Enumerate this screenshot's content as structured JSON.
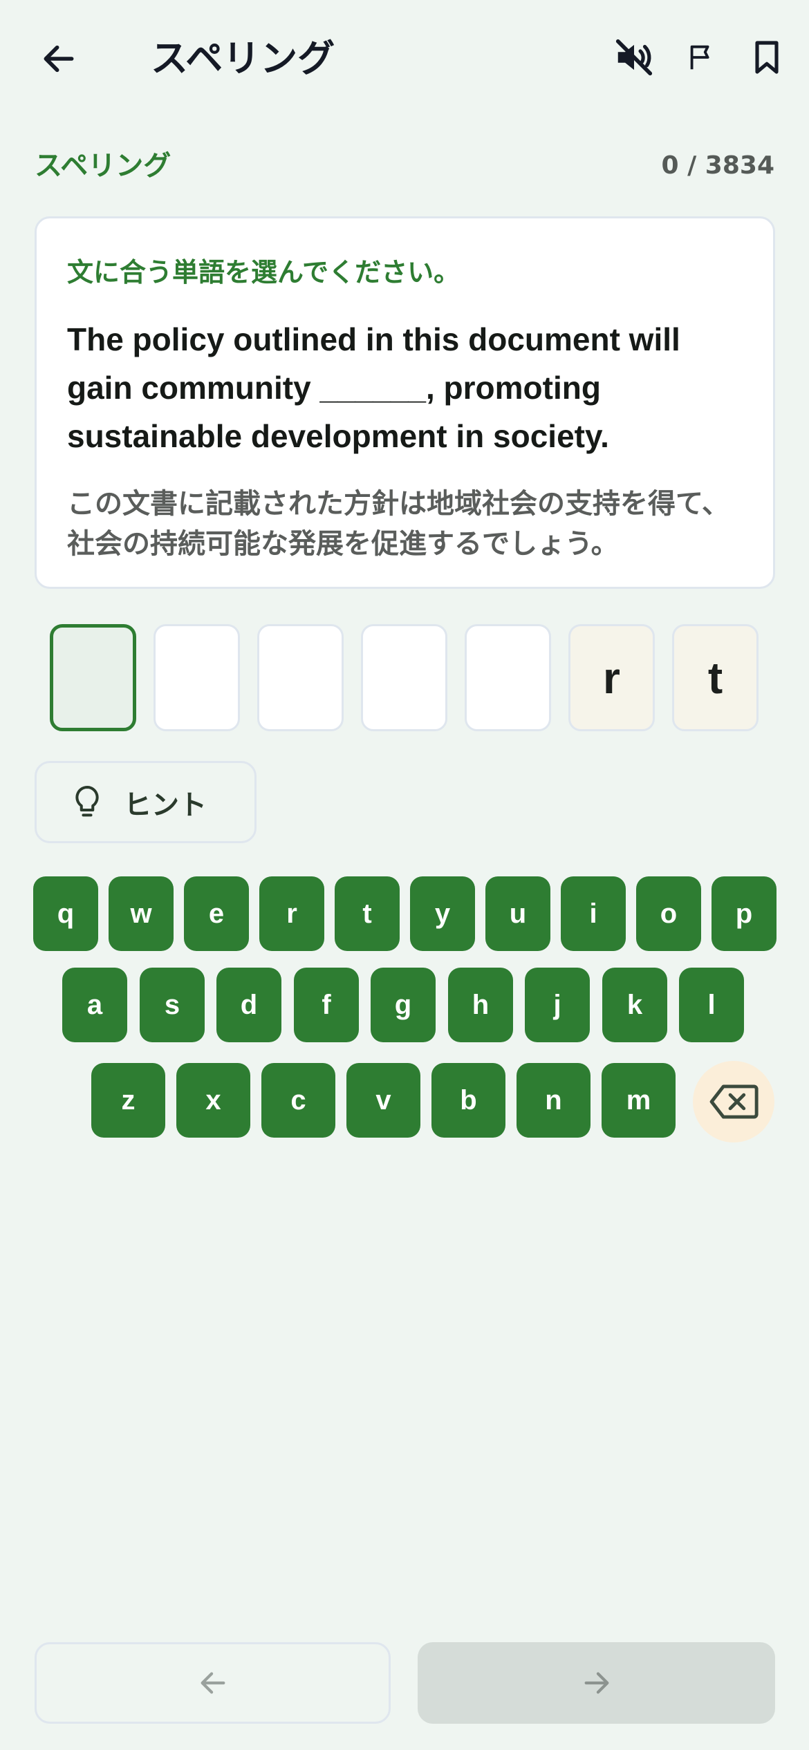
{
  "header": {
    "title": "スペリング",
    "back_icon": "arrow-left-icon",
    "mute_icon": "volume-off-icon",
    "flag_icon": "flag-icon",
    "bookmark_icon": "bookmark-icon"
  },
  "section": {
    "label": "スペリング",
    "progress": "0 / 3834"
  },
  "question": {
    "instruction": "文に合う単語を選んでください。",
    "sentence": "The policy outlined in this document will gain community ______, promoting sustainable development in society.",
    "translation": "この文書に記載された方針は地域社会の支持を得て、社会の持続可能な発展を促進するでしょう。"
  },
  "answer": {
    "letters": [
      "",
      "",
      "",
      "",
      "",
      "r",
      "t"
    ],
    "active_index": 0,
    "given_indices": [
      5,
      6
    ]
  },
  "hint": {
    "label": "ヒント",
    "icon": "lightbulb-icon"
  },
  "keyboard": {
    "row1": [
      "q",
      "w",
      "e",
      "r",
      "t",
      "y",
      "u",
      "i",
      "o",
      "p"
    ],
    "row2": [
      "a",
      "s",
      "d",
      "f",
      "g",
      "h",
      "j",
      "k",
      "l"
    ],
    "row3": [
      "z",
      "x",
      "c",
      "v",
      "b",
      "n",
      "m"
    ],
    "backspace_icon": "backspace-icon"
  },
  "nav": {
    "prev_icon": "arrow-left-icon",
    "next_icon": "arrow-right-icon"
  },
  "colors": {
    "accent": "#2e7d32",
    "background": "#eff5f1",
    "backspace_bg": "#fbeed9",
    "next_disabled": "#d5dcd8"
  }
}
